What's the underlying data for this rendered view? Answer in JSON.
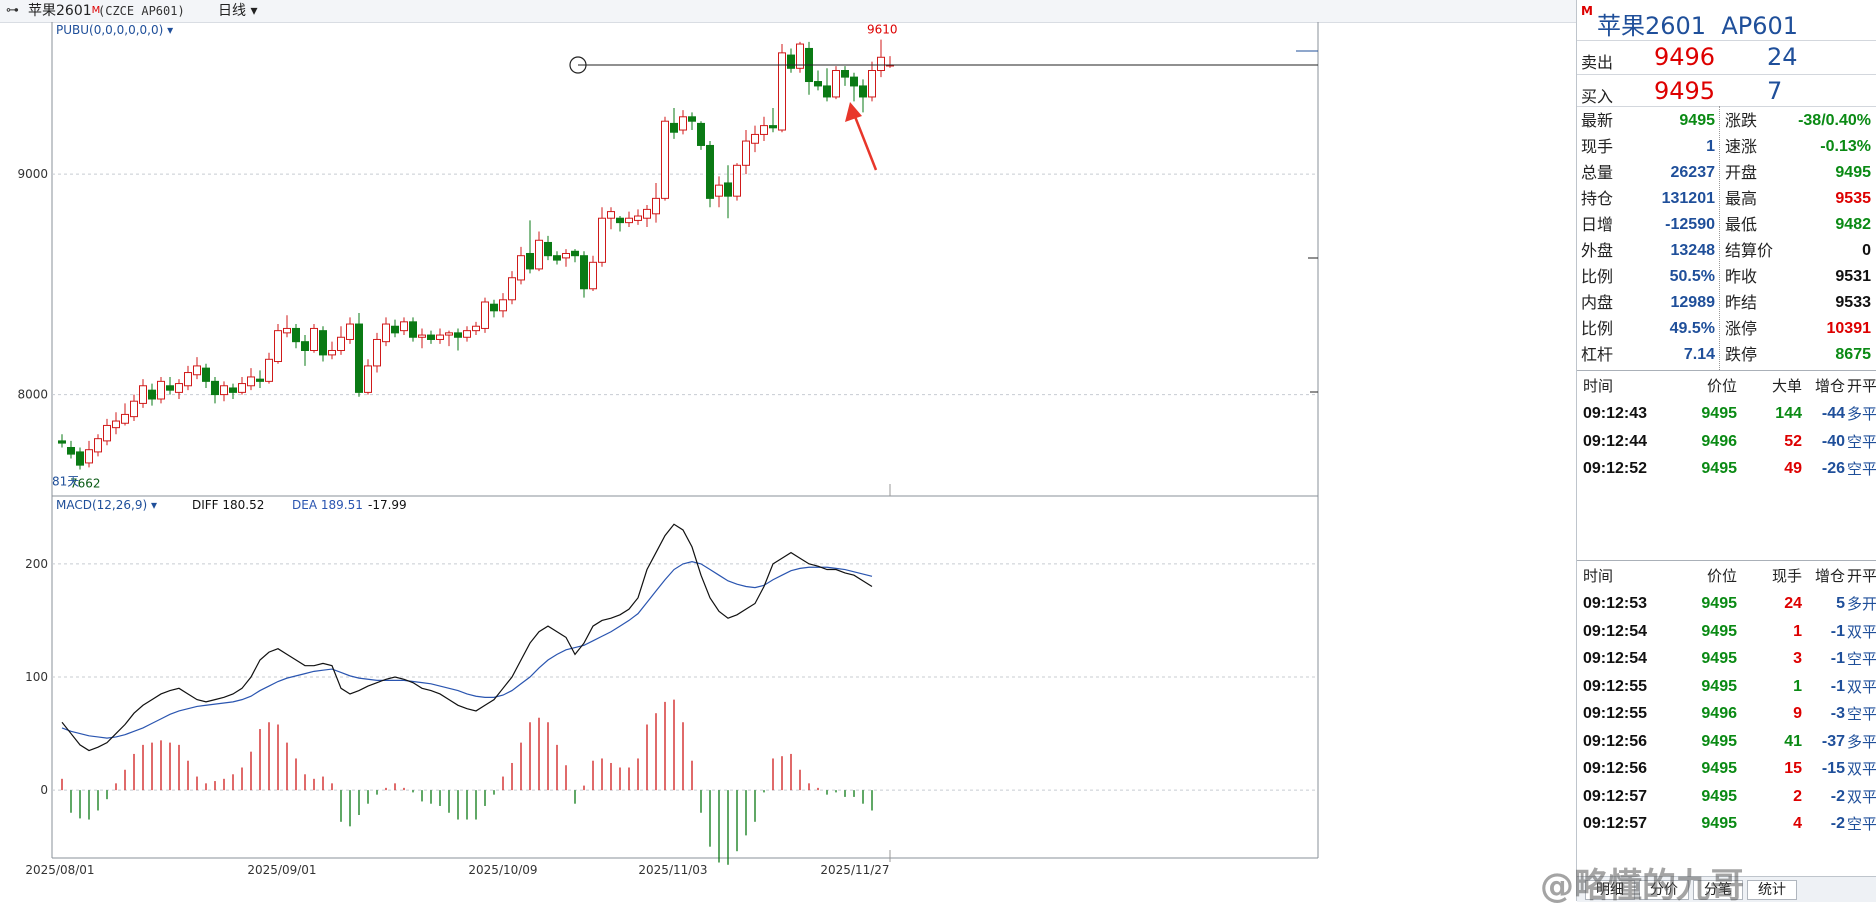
{
  "header": {
    "link_icon": "⊶",
    "title": "苹果2601",
    "superscript": "M",
    "code": "(CZCE AP601)",
    "period": "日线",
    "period_icon": "chevron-down-icon"
  },
  "chart": {
    "indicator_main": "PUBU(0,0,0,0,0,0)",
    "price_ticks": [
      "9000",
      "8000"
    ],
    "high_label": "9610",
    "low_label": "7662",
    "days_label": "81天",
    "macd_label": "MACD(12,26,9)",
    "diff_label": "DIFF 180.52",
    "dea_label": "DEA 189.51",
    "macd_value": "-17.99",
    "macd_ticks": [
      "200",
      "100",
      "0"
    ],
    "date_labels": [
      "2025/08/01",
      "2025/09/01",
      "2025/10/09",
      "2025/11/03",
      "2025/11/27"
    ]
  },
  "chart_data": {
    "type": "candlestick",
    "title": "苹果2601 (CZCE AP601) 日线",
    "ylim": [
      7540,
      9690
    ],
    "candles": [
      [
        7790,
        7780,
        7820,
        7760
      ],
      [
        7760,
        7730,
        7790,
        7710
      ],
      [
        7740,
        7680,
        7760,
        7660
      ],
      [
        7690,
        7750,
        7790,
        7670
      ],
      [
        7740,
        7800,
        7820,
        7720
      ],
      [
        7790,
        7860,
        7890,
        7770
      ],
      [
        7850,
        7880,
        7920,
        7820
      ],
      [
        7870,
        7910,
        7960,
        7860
      ],
      [
        7900,
        7970,
        8000,
        7880
      ],
      [
        7960,
        8040,
        8070,
        7940
      ],
      [
        8020,
        7980,
        8050,
        7950
      ],
      [
        7980,
        8060,
        8080,
        7960
      ],
      [
        8040,
        8020,
        8080,
        8000
      ],
      [
        8010,
        8050,
        8070,
        7980
      ],
      [
        8040,
        8100,
        8130,
        8020
      ],
      [
        8090,
        8130,
        8170,
        8070
      ],
      [
        8120,
        8060,
        8140,
        8030
      ],
      [
        8060,
        8000,
        8080,
        7960
      ],
      [
        8000,
        8040,
        8060,
        7970
      ],
      [
        8030,
        8010,
        8050,
        7980
      ],
      [
        8010,
        8050,
        8080,
        8000
      ],
      [
        8040,
        8080,
        8120,
        8020
      ],
      [
        8070,
        8060,
        8110,
        8030
      ],
      [
        8060,
        8160,
        8190,
        8050
      ],
      [
        8150,
        8290,
        8320,
        8140
      ],
      [
        8280,
        8300,
        8360,
        8260
      ],
      [
        8300,
        8240,
        8320,
        8210
      ],
      [
        8240,
        8200,
        8270,
        8130
      ],
      [
        8200,
        8300,
        8320,
        8190
      ],
      [
        8290,
        8180,
        8310,
        8150
      ],
      [
        8180,
        8200,
        8240,
        8160
      ],
      [
        8200,
        8260,
        8310,
        8180
      ],
      [
        8250,
        8320,
        8350,
        8230
      ],
      [
        8320,
        8010,
        8370,
        7990
      ],
      [
        8010,
        8130,
        8160,
        8000
      ],
      [
        8130,
        8250,
        8280,
        8100
      ],
      [
        8240,
        8320,
        8350,
        8220
      ],
      [
        8310,
        8280,
        8340,
        8260
      ],
      [
        8290,
        8330,
        8350,
        8270
      ],
      [
        8330,
        8260,
        8350,
        8240
      ],
      [
        8260,
        8270,
        8300,
        8210
      ],
      [
        8270,
        8250,
        8290,
        8230
      ],
      [
        8250,
        8270,
        8300,
        8230
      ],
      [
        8270,
        8280,
        8290,
        8220
      ],
      [
        8280,
        8260,
        8300,
        8200
      ],
      [
        8260,
        8290,
        8310,
        8240
      ],
      [
        8290,
        8310,
        8330,
        8270
      ],
      [
        8300,
        8420,
        8440,
        8280
      ],
      [
        8410,
        8380,
        8430,
        8350
      ],
      [
        8380,
        8430,
        8460,
        8350
      ],
      [
        8430,
        8530,
        8560,
        8410
      ],
      [
        8520,
        8630,
        8670,
        8500
      ],
      [
        8640,
        8570,
        8790,
        8550
      ],
      [
        8570,
        8700,
        8740,
        8560
      ],
      [
        8690,
        8630,
        8720,
        8610
      ],
      [
        8630,
        8610,
        8650,
        8590
      ],
      [
        8620,
        8640,
        8660,
        8580
      ],
      [
        8650,
        8630,
        8660,
        8600
      ],
      [
        8630,
        8480,
        8650,
        8440
      ],
      [
        8480,
        8600,
        8630,
        8470
      ],
      [
        8600,
        8800,
        8850,
        8580
      ],
      [
        8800,
        8830,
        8850,
        8750
      ],
      [
        8800,
        8780,
        8810,
        8740
      ],
      [
        8780,
        8800,
        8830,
        8760
      ],
      [
        8790,
        8810,
        8840,
        8770
      ],
      [
        8800,
        8840,
        8860,
        8760
      ],
      [
        8820,
        8890,
        8960,
        8780
      ],
      [
        8890,
        9240,
        9260,
        8880
      ],
      [
        9230,
        9190,
        9300,
        9160
      ],
      [
        9200,
        9260,
        9290,
        9180
      ],
      [
        9260,
        9240,
        9280,
        9200
      ],
      [
        9230,
        9130,
        9240,
        9110
      ],
      [
        9130,
        8890,
        9150,
        8850
      ],
      [
        8900,
        8950,
        8990,
        8850
      ],
      [
        8960,
        8900,
        9040,
        8800
      ],
      [
        8900,
        9040,
        9050,
        8880
      ],
      [
        9040,
        9150,
        9200,
        9000
      ],
      [
        9140,
        9180,
        9220,
        9100
      ],
      [
        9180,
        9220,
        9260,
        9150
      ],
      [
        9220,
        9210,
        9300,
        9190
      ],
      [
        9200,
        9550,
        9590,
        9190
      ],
      [
        9540,
        9480,
        9570,
        9460
      ],
      [
        9480,
        9590,
        9600,
        9460
      ],
      [
        9570,
        9420,
        9600,
        9360
      ],
      [
        9420,
        9400,
        9470,
        9380
      ],
      [
        9400,
        9350,
        9480,
        9330
      ],
      [
        9350,
        9470,
        9490,
        9340
      ],
      [
        9470,
        9440,
        9490,
        9400
      ],
      [
        9440,
        9400,
        9460,
        9330
      ],
      [
        9400,
        9350,
        9430,
        9280
      ],
      [
        9350,
        9470,
        9510,
        9330
      ],
      [
        9470,
        9530,
        9610,
        9440
      ],
      [
        9495,
        9495,
        9535,
        9482
      ]
    ],
    "macd": {
      "ylim": [
        -60,
        260
      ],
      "diff": [
        60,
        50,
        40,
        35,
        38,
        42,
        50,
        58,
        68,
        75,
        80,
        85,
        88,
        90,
        85,
        80,
        78,
        80,
        82,
        85,
        90,
        100,
        115,
        122,
        125,
        120,
        115,
        110,
        110,
        112,
        110,
        90,
        85,
        88,
        92,
        95,
        98,
        100,
        98,
        95,
        90,
        88,
        85,
        80,
        75,
        72,
        70,
        75,
        80,
        90,
        100,
        115,
        130,
        140,
        145,
        140,
        135,
        120,
        130,
        145,
        150,
        152,
        155,
        160,
        170,
        195,
        210,
        225,
        235,
        230,
        215,
        190,
        170,
        158,
        152,
        155,
        160,
        165,
        180,
        200,
        205,
        210,
        205,
        200,
        198,
        195,
        195,
        192,
        190,
        185,
        180
      ],
      "dea": [
        55,
        52,
        50,
        48,
        47,
        46,
        47,
        49,
        52,
        55,
        59,
        63,
        67,
        70,
        72,
        74,
        75,
        76,
        77,
        78,
        80,
        83,
        88,
        92,
        96,
        99,
        101,
        103,
        105,
        106,
        107,
        104,
        101,
        99,
        98,
        97,
        97,
        97,
        97,
        96,
        95,
        94,
        92,
        90,
        88,
        85,
        83,
        82,
        82,
        84,
        88,
        94,
        100,
        108,
        115,
        120,
        124,
        126,
        128,
        132,
        136,
        140,
        145,
        150,
        156,
        166,
        176,
        186,
        195,
        200,
        202,
        200,
        195,
        190,
        185,
        182,
        180,
        179,
        181,
        186,
        190,
        194,
        196,
        197,
        197,
        197,
        196,
        195,
        193,
        191,
        189
      ],
      "hist": [
        10,
        -20,
        -25,
        -26,
        -18,
        -8,
        6,
        18,
        32,
        40,
        42,
        44,
        42,
        40,
        26,
        12,
        6,
        8,
        10,
        14,
        20,
        34,
        54,
        60,
        58,
        42,
        28,
        14,
        10,
        12,
        6,
        -28,
        -32,
        -22,
        -12,
        -4,
        2,
        6,
        2,
        -2,
        -10,
        -12,
        -14,
        -20,
        -26,
        -26,
        -26,
        -14,
        -4,
        12,
        24,
        42,
        60,
        64,
        60,
        40,
        22,
        -12,
        4,
        26,
        28,
        24,
        20,
        20,
        28,
        58,
        68,
        78,
        80,
        60,
        26,
        -20,
        -50,
        -64,
        -66,
        -54,
        -40,
        -28,
        -2,
        28,
        30,
        32,
        18,
        6,
        2,
        -4,
        -2,
        -6,
        -6,
        -12,
        -18
      ]
    },
    "price_line": 9495
  },
  "quote": {
    "market_sup": "M",
    "name": "苹果2601",
    "code": "AP601",
    "ask_label": "卖出",
    "ask_price": "9496",
    "ask_vol": "24",
    "bid_label": "买入",
    "bid_price": "9495",
    "bid_vol": "7",
    "left": [
      {
        "k": "最新",
        "v": "9495",
        "c": "green"
      },
      {
        "k": "现手",
        "v": "1",
        "c": "blue"
      },
      {
        "k": "总量",
        "v": "26237",
        "c": "blue"
      },
      {
        "k": "持仓",
        "v": "131201",
        "c": "blue"
      },
      {
        "k": "日增",
        "v": "-12590",
        "c": "blue"
      },
      {
        "k": "外盘",
        "v": "13248",
        "c": "blue"
      },
      {
        "k": "比例",
        "v": "50.5%",
        "c": "blue"
      },
      {
        "k": "内盘",
        "v": "12989",
        "c": "blue"
      },
      {
        "k": "比例",
        "v": "49.5%",
        "c": "blue"
      },
      {
        "k": "杠杆",
        "v": "7.14",
        "c": "blue"
      }
    ],
    "right": [
      {
        "k": "涨跌",
        "v": "-38/0.40%",
        "c": "green"
      },
      {
        "k": "速涨",
        "v": "-0.13%",
        "c": "green"
      },
      {
        "k": "开盘",
        "v": "9495",
        "c": "green"
      },
      {
        "k": "最高",
        "v": "9535",
        "c": "red"
      },
      {
        "k": "最低",
        "v": "9482",
        "c": "green"
      },
      {
        "k": "结算价",
        "v": "0",
        "c": "black"
      },
      {
        "k": "昨收",
        "v": "9531",
        "c": "black"
      },
      {
        "k": "昨结",
        "v": "9533",
        "c": "black"
      },
      {
        "k": "涨停",
        "v": "10391",
        "c": "red"
      },
      {
        "k": "跌停",
        "v": "8675",
        "c": "green"
      }
    ]
  },
  "big_orders": {
    "headers": [
      "时间",
      "价位",
      "大单",
      "增仓",
      "开平"
    ],
    "rows": [
      {
        "t": "09:12:43",
        "p": "9495",
        "pc": "green",
        "v": "144",
        "vc": "green",
        "d": "-44",
        "o": "多平"
      },
      {
        "t": "09:12:44",
        "p": "9496",
        "pc": "green",
        "v": "52",
        "vc": "red",
        "d": "-40",
        "o": "空平"
      },
      {
        "t": "09:12:52",
        "p": "9495",
        "pc": "green",
        "v": "49",
        "vc": "red",
        "d": "-26",
        "o": "空平"
      }
    ]
  },
  "ticks": {
    "headers": [
      "时间",
      "价位",
      "现手",
      "增仓",
      "开平"
    ],
    "rows": [
      {
        "t": "09:12:53",
        "p": "9495",
        "pc": "green",
        "v": "24",
        "vc": "red",
        "d": "5",
        "o": "多开"
      },
      {
        "t": "09:12:54",
        "p": "9495",
        "pc": "green",
        "v": "1",
        "vc": "red",
        "d": "-1",
        "o": "双平"
      },
      {
        "t": "09:12:54",
        "p": "9495",
        "pc": "green",
        "v": "3",
        "vc": "red",
        "d": "-1",
        "o": "空平"
      },
      {
        "t": "09:12:55",
        "p": "9495",
        "pc": "green",
        "v": "1",
        "vc": "green",
        "d": "-1",
        "o": "双平"
      },
      {
        "t": "09:12:55",
        "p": "9496",
        "pc": "green",
        "v": "9",
        "vc": "red",
        "d": "-3",
        "o": "空平"
      },
      {
        "t": "09:12:56",
        "p": "9495",
        "pc": "green",
        "v": "41",
        "vc": "green",
        "d": "-37",
        "o": "多平"
      },
      {
        "t": "09:12:56",
        "p": "9495",
        "pc": "green",
        "v": "15",
        "vc": "red",
        "d": "-15",
        "o": "双平"
      },
      {
        "t": "09:12:57",
        "p": "9495",
        "pc": "green",
        "v": "2",
        "vc": "red",
        "d": "-2",
        "o": "双平"
      },
      {
        "t": "09:12:57",
        "p": "9495",
        "pc": "green",
        "v": "4",
        "vc": "red",
        "d": "-2",
        "o": "空平"
      }
    ]
  },
  "tabs": [
    "明细",
    "分价",
    "分笔",
    "统计"
  ],
  "watermark": "@略懂的九哥",
  "colors": {
    "up": "#d01a1a",
    "down": "#0a7a14",
    "diff": "#111111",
    "dea": "#2a55b0",
    "accent": "#1f4f9a"
  }
}
